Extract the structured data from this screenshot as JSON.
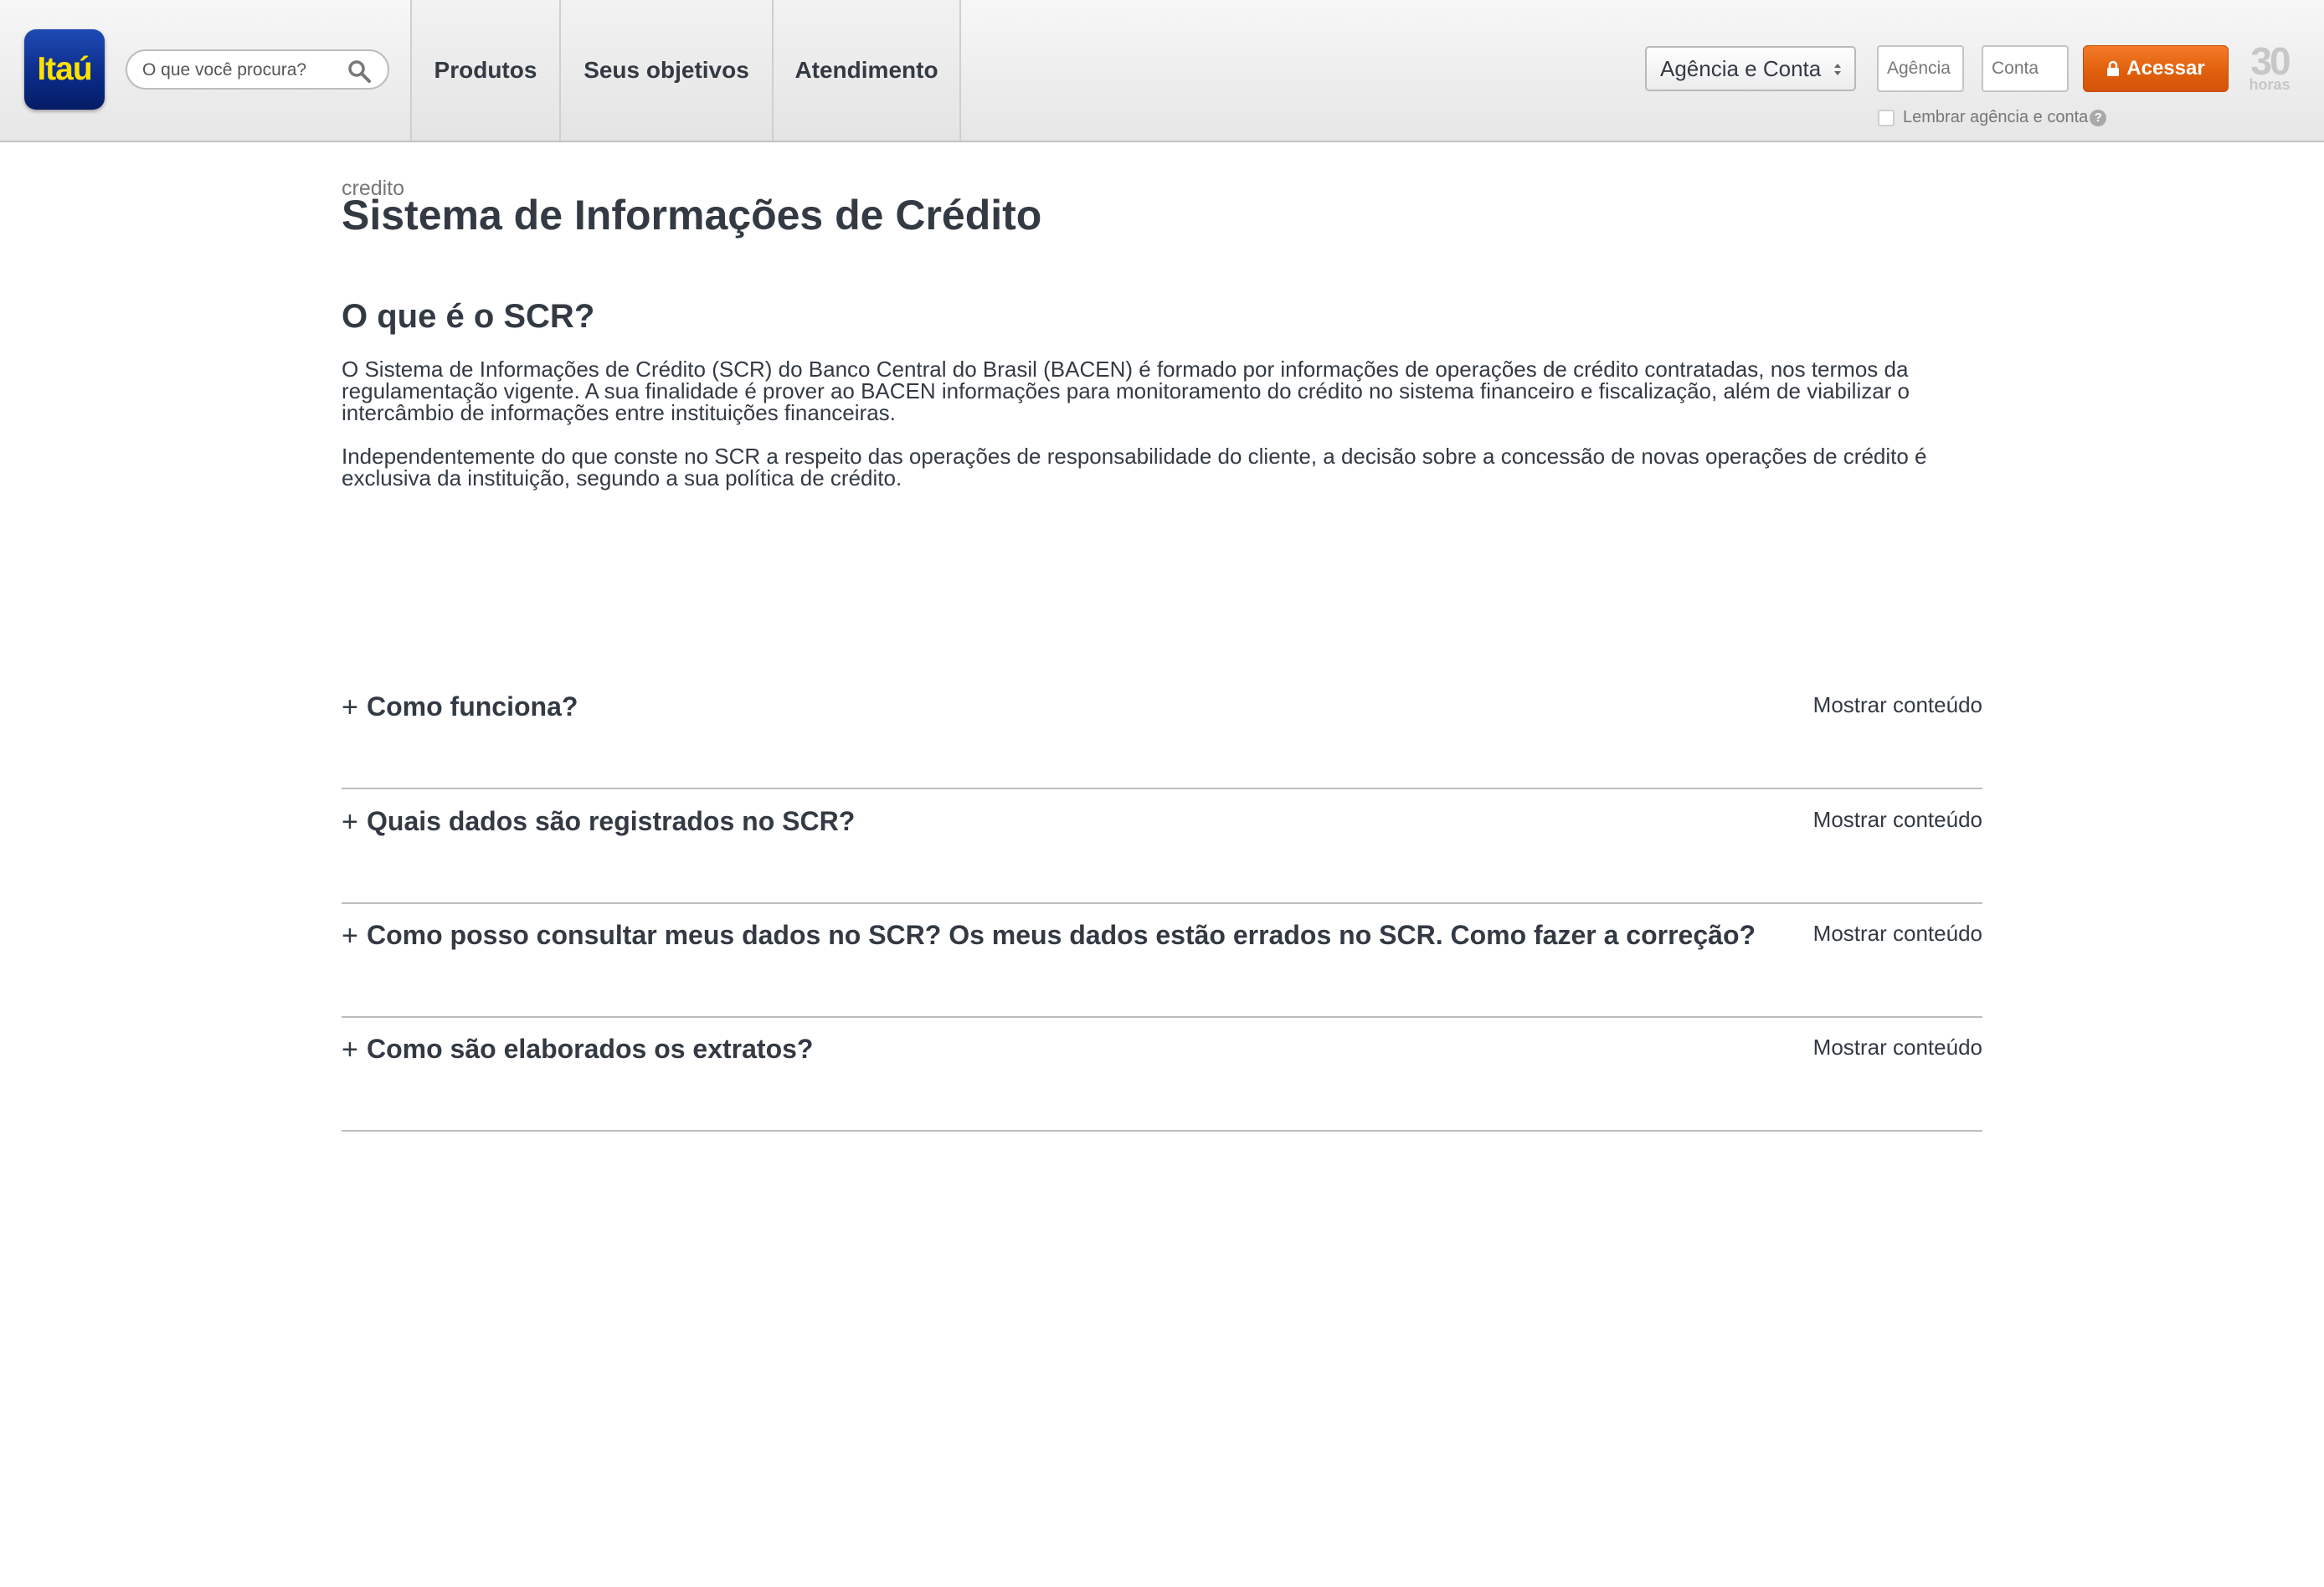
{
  "header": {
    "logo_text": "Itaú",
    "search": {
      "placeholder": "O que você procura?"
    },
    "nav": [
      "Produtos",
      "Seus objetivos",
      "Atendimento"
    ],
    "login": {
      "select_label": "Agência e Conta",
      "agencia_placeholder": "Agência",
      "conta_placeholder": "Conta",
      "button_label": "Acessar",
      "remember_label": "Lembrar agência e conta",
      "help_symbol": "?",
      "badge_number": "30",
      "badge_text": "horas"
    }
  },
  "page": {
    "breadcrumb": "credito",
    "title": "Sistema de Informações de Crédito",
    "section_title": "O que é o SCR?",
    "paragraphs": [
      "O Sistema de Informações de Crédito (SCR) do Banco Central do Brasil (BACEN) é formado por informações de operações de crédito contratadas, nos termos da regulamentação vigente. A sua finalidade é prover ao BACEN informações para monitoramento do crédito no sistema financeiro e fiscalização, além de viabilizar o intercâmbio de informações entre instituições financeiras.",
      "Independentemente do que conste no SCR a respeito das operações de responsabilidade do cliente, a decisão sobre a concessão de novas operações de crédito é exclusiva da instituição, segundo a sua política de crédito."
    ],
    "accordion": [
      {
        "symbol": "+",
        "question": "Como funciona?",
        "toggle": "Mostrar conteúdo"
      },
      {
        "symbol": "+",
        "question": "Quais dados são registrados no SCR?",
        "toggle": "Mostrar conteúdo"
      },
      {
        "symbol": "+",
        "question": "Como posso consultar meus dados no SCR? Os meus dados estão errados no SCR. Como fazer a correção?",
        "toggle": "Mostrar conteúdo"
      },
      {
        "symbol": "+",
        "question": "Como são elaborados os extratos?",
        "toggle": "Mostrar conteúdo"
      }
    ]
  },
  "colors": {
    "brand_blue": "#0a2a86",
    "brand_yellow": "#ffe100",
    "button_orange": "#e0600c",
    "text": "#333a43"
  },
  "icons": [
    "search-icon",
    "select-arrows-icon",
    "lock-icon",
    "help-icon"
  ]
}
